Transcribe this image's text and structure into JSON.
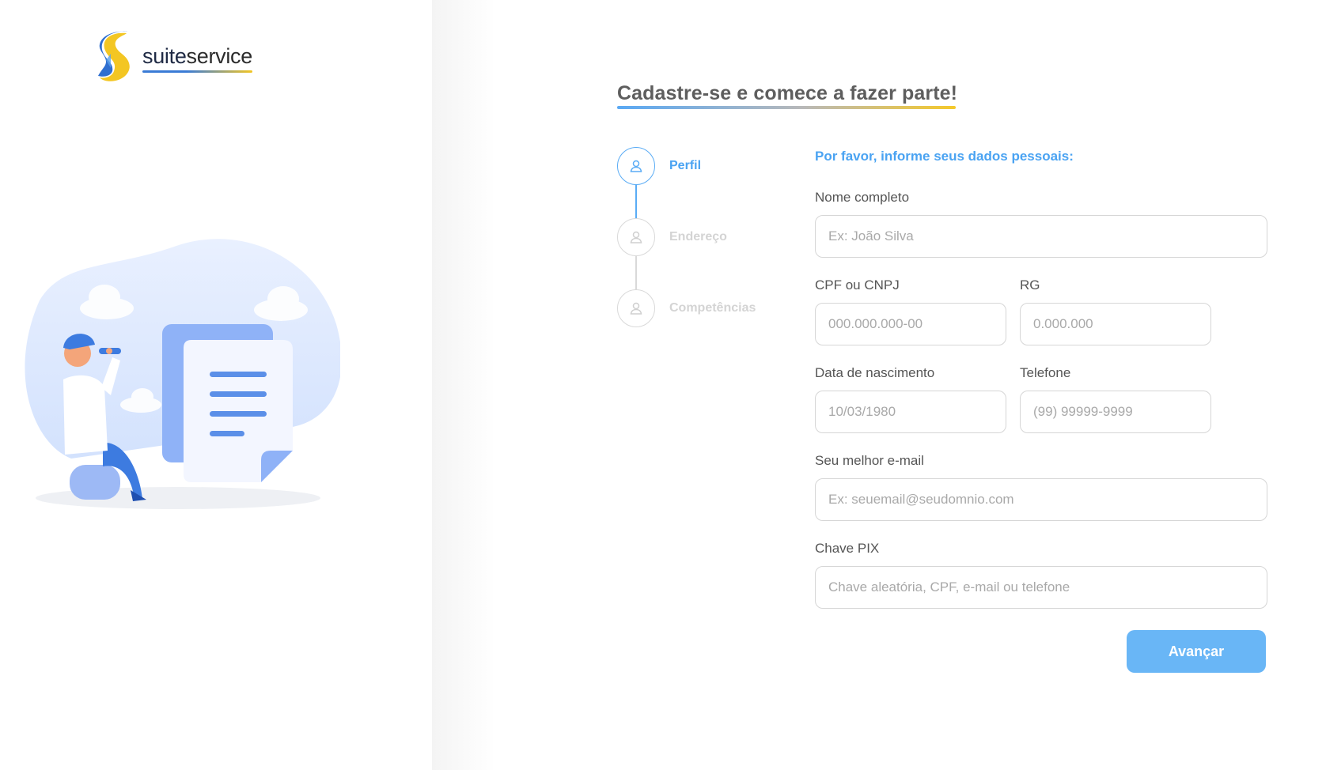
{
  "brand": {
    "name_part1": "suite",
    "name_part2": "service"
  },
  "header": {
    "title": "Cadastre-se e comece a fazer parte!"
  },
  "stepper": {
    "steps": [
      {
        "label": "Perfil",
        "icon": "user-icon",
        "active": true
      },
      {
        "label": "Endereço",
        "icon": "user-icon",
        "active": false
      },
      {
        "label": "Competências",
        "icon": "user-icon",
        "active": false
      }
    ]
  },
  "form": {
    "intro": "Por favor, informe seus dados pessoais:",
    "fields": {
      "nome": {
        "label": "Nome completo",
        "placeholder": "Ex: João Silva"
      },
      "cpf": {
        "label": "CPF ou CNPJ",
        "placeholder": "000.000.000-00"
      },
      "rg": {
        "label": "RG",
        "placeholder": "0.000.000"
      },
      "nascimento": {
        "label": "Data de nascimento",
        "placeholder": "10/03/1980"
      },
      "telefone": {
        "label": "Telefone",
        "placeholder": "(99) 99999-9999"
      },
      "email": {
        "label": "Seu melhor e-mail",
        "placeholder": "Ex: seuemail@seudomnio.com"
      },
      "pix": {
        "label": "Chave PIX",
        "placeholder": "Chave aleatória, CPF, e-mail ou telefone"
      }
    },
    "submit_label": "Avançar"
  },
  "colors": {
    "accent": "#4aa3f2",
    "button": "#69b6f6",
    "brand_blue": "#3a7bd5",
    "brand_yellow": "#f3c623"
  }
}
